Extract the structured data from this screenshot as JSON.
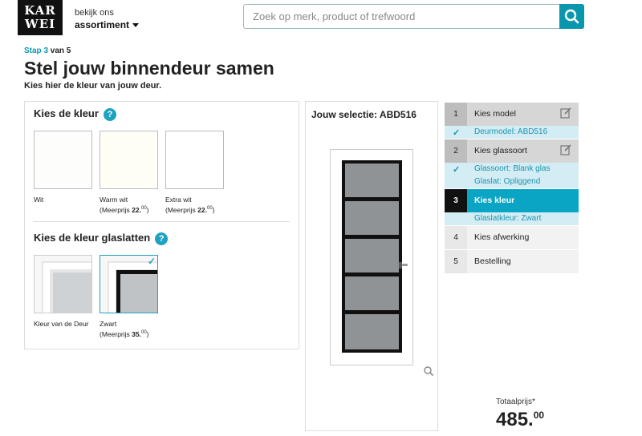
{
  "header": {
    "logo_top": "KAR",
    "logo_bottom": "WEI",
    "assortment_small": "bekijk ons",
    "assortment_big": "assortiment",
    "search_placeholder": "Zoek op merk, product of trefwoord"
  },
  "page": {
    "step_label": "Stap 3",
    "step_of": " van 5",
    "title": "Stel jouw binnendeur samen",
    "subtitle": "Kies hier de kleur van jouw deur."
  },
  "color_section": {
    "title": "Kies de kleur",
    "help": "?",
    "options": [
      {
        "name": "Wit",
        "extra": "",
        "price_main": "",
        "price_sup": "",
        "price_close": "",
        "fill": "#fdfdfb"
      },
      {
        "name": "Warm wit",
        "extra": "(Meerprijs ",
        "price_main": "22.",
        "price_sup": "00",
        "price_close": ")",
        "fill": "#fffef5"
      },
      {
        "name": "Extra wit",
        "extra": "(Meerprijs ",
        "price_main": "22.",
        "price_sup": "00",
        "price_close": ")",
        "fill": "#ffffff"
      }
    ]
  },
  "glas_section": {
    "title": "Kies de kleur glaslatten",
    "help": "?",
    "options": [
      {
        "name": "Kleur van de Deur",
        "extra": "",
        "price_main": "",
        "price_sup": "",
        "price_close": ""
      },
      {
        "name": "Zwart",
        "extra": "(Meerprijs ",
        "price_main": "35.",
        "price_sup": "00",
        "price_close": ")"
      }
    ]
  },
  "selection": {
    "title": "Jouw selectie: ABD516"
  },
  "steps": [
    {
      "num": "1",
      "label": "Kies model",
      "sub": [
        "Deurmodel: ABD516"
      ]
    },
    {
      "num": "2",
      "label": "Kies glassoort",
      "sub": [
        "Glassoort: Blank glas",
        "Glaslat: Opliggend"
      ]
    },
    {
      "num": "3",
      "label": "Kies kleur",
      "sub": [
        "Glaslatkleur: Zwart"
      ]
    },
    {
      "num": "4",
      "label": "Kies afwerking"
    },
    {
      "num": "5",
      "label": "Bestelling"
    }
  ],
  "total": {
    "label": "Totaalprijs*",
    "main": "485.",
    "sup": "00"
  },
  "colors": {
    "accent": "#0aa5c4",
    "active_num_bg": "#111111",
    "sub_bg": "#d4edf4"
  }
}
